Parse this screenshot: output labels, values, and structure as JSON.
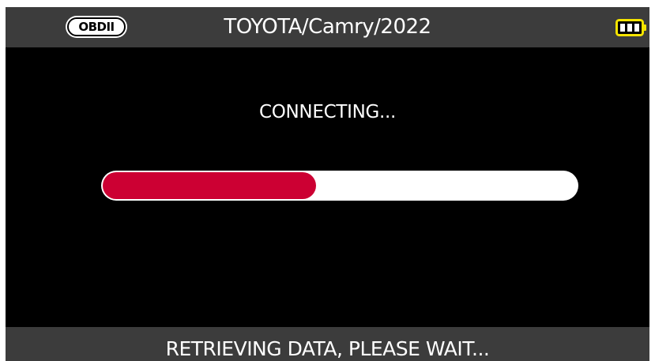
{
  "header": {
    "connection_badge": "OBDII",
    "vehicle_title": "TOYOTA/Camry/2022",
    "battery_icon": "battery-full-icon"
  },
  "main": {
    "status_text": "CONNECTING...",
    "progress": {
      "percent": 45,
      "fill_color": "#cc0033",
      "track_color": "#ffffff"
    }
  },
  "footer": {
    "message": "RETRIEVING DATA, PLEASE WAIT..."
  },
  "colors": {
    "background": "#000000",
    "bar_background": "#3c3c3c",
    "accent_battery": "#f5e400"
  }
}
